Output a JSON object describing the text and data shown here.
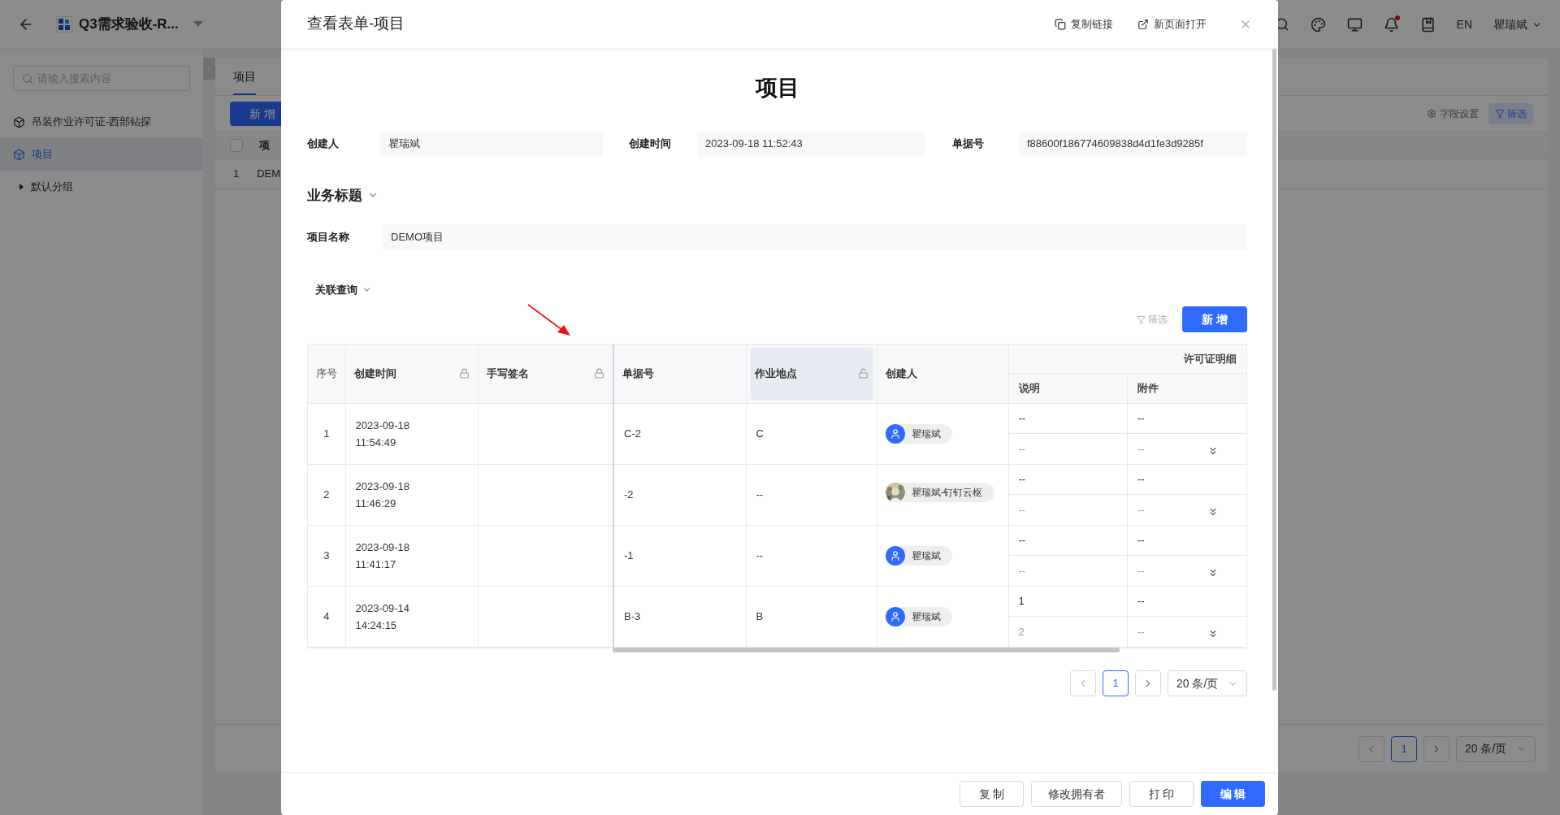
{
  "app": {
    "title": "Q3需求验收-R...",
    "language": "EN",
    "user": "瞿瑞斌"
  },
  "sidebar": {
    "search": {
      "placeholder": "请输入搜索内容"
    },
    "items": [
      {
        "label": "吊装作业许可证-西部钻探",
        "kind": "form",
        "selected": false
      },
      {
        "label": "项目",
        "kind": "form",
        "selected": true
      },
      {
        "label": "默认分组",
        "kind": "group",
        "selected": false
      }
    ]
  },
  "main": {
    "tabs": [
      {
        "label": "项目",
        "selected": true
      }
    ],
    "add_button": "新 增",
    "field_settings": "字段设置",
    "filter_button": "筛选",
    "table": {
      "all_checked": false,
      "column_2": "项",
      "rows": [
        {
          "index": "1",
          "column_2": "DEM"
        }
      ]
    },
    "pagination": {
      "pages": [
        {
          "label": "1",
          "selected": true
        }
      ],
      "page_size": "20 条/页"
    }
  },
  "modal": {
    "title": "查看表单-项目",
    "actions": [
      {
        "label": "复制链接",
        "kind": "copy"
      },
      {
        "label": "新页面打开",
        "kind": "open"
      }
    ],
    "heading": "项目",
    "fields": [
      {
        "label": "创建人",
        "value": "瞿瑞斌"
      },
      {
        "label": "创建时间",
        "value": "2023-09-18 11:52:43"
      },
      {
        "label": "单据号",
        "value": "f88600f186774609838d4d1fe3d9285f"
      }
    ],
    "section": {
      "title": "业务标题",
      "fields": [
        {
          "label": "项目名称",
          "value": "DEMO项目"
        }
      ]
    },
    "related": {
      "title": "关联查询",
      "filter": "筛选",
      "add_button": "新 增",
      "columns": [
        {
          "label": "序号",
          "highlighted": false
        },
        {
          "label": "创建时间",
          "locked": true,
          "highlighted": false
        },
        {
          "label": "手写签名",
          "locked": true,
          "highlighted": false
        },
        {
          "label": "单据号",
          "highlighted": false
        },
        {
          "label": "作业地点",
          "locked": false,
          "highlighted": true
        },
        {
          "label": "创建人",
          "highlighted": false
        }
      ],
      "group": {
        "label": "许可证明细",
        "columns": [
          "说明",
          "附件"
        ]
      },
      "rows": [
        {
          "index": "1",
          "created": "2023-09-18 11:54:49",
          "number": "C-2",
          "site": "C",
          "creator": {
            "name": "瞿瑞斌",
            "has_photo": false
          },
          "details": [
            {
              "description": "--",
              "attachment": "--",
              "faded": false
            },
            {
              "description": "--",
              "attachment": "--",
              "faded": true
            }
          ]
        },
        {
          "index": "2",
          "created": "2023-09-18 11:46:29",
          "number": "-2",
          "site": "--",
          "creator": {
            "name": "瞿瑞斌-钉钉云枢",
            "has_photo": true
          },
          "details": [
            {
              "description": "--",
              "attachment": "--",
              "faded": false
            },
            {
              "description": "--",
              "attachment": "--",
              "faded": true
            }
          ]
        },
        {
          "index": "3",
          "created": "2023-09-18 11:41:17",
          "number": "-1",
          "site": "--",
          "creator": {
            "name": "瞿瑞斌",
            "has_photo": false
          },
          "details": [
            {
              "description": "--",
              "attachment": "--",
              "faded": false
            },
            {
              "description": "--",
              "attachment": "--",
              "faded": true
            }
          ]
        },
        {
          "index": "4",
          "created": "2023-09-14 14:24:15",
          "number": "B-3",
          "site": "B",
          "creator": {
            "name": "瞿瑞斌",
            "has_photo": false
          },
          "details": [
            {
              "description": "1",
              "attachment": "--",
              "faded": false
            },
            {
              "description": "2",
              "attachment": "--",
              "faded": true
            }
          ]
        }
      ],
      "pagination": {
        "pages": [
          {
            "label": "1",
            "selected": true
          }
        ],
        "page_size": "20 条/页"
      }
    },
    "footer": [
      {
        "label": "复 制",
        "primary": false
      },
      {
        "label": "修改拥有者",
        "primary": false
      },
      {
        "label": "打 印",
        "primary": false
      },
      {
        "label": "编 辑",
        "primary": true
      }
    ]
  }
}
